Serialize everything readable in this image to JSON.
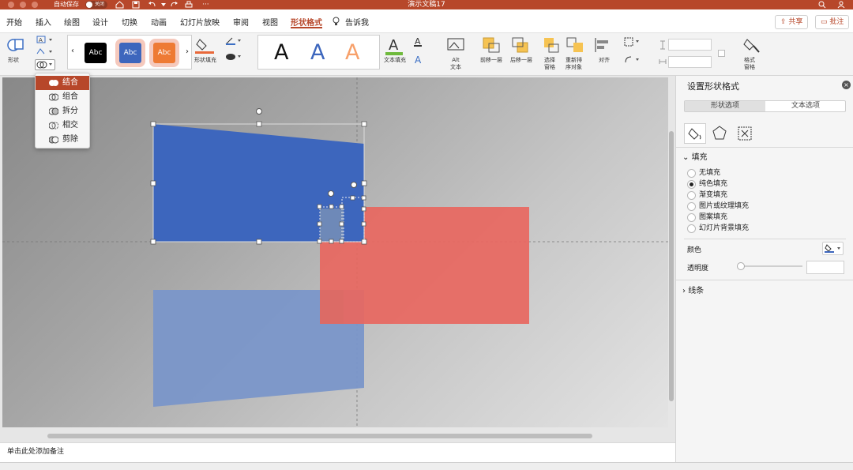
{
  "titlebar": {
    "autosave_label": "自动保存",
    "autosave_toggle": "关闭",
    "doc_title": "演示文稿17",
    "quick_more": "···"
  },
  "tabs": [
    "开始",
    "插入",
    "绘图",
    "设计",
    "切换",
    "动画",
    "幻灯片放映",
    "审阅",
    "视图",
    "形状格式"
  ],
  "tell_me": "告诉我",
  "share_label": "共享",
  "comment_label": "批注",
  "ribbon": {
    "shapes_label": "形状",
    "style_samples": [
      "Abc",
      "Abc",
      "Abc"
    ],
    "shape_fill_label": "形状填充",
    "wordart_samples": [
      "A",
      "A",
      "A"
    ],
    "text_fill_label": "文本填充",
    "alt_text_label": "Alt\n文本",
    "bring_forward_label": "前移一层",
    "send_backward_label": "后移一层",
    "selection_pane_label": "选择\n窗格",
    "reorder_label": "重新排\n序对象",
    "align_label": "对齐",
    "format_pane_label": "格式\n窗格"
  },
  "merge_menu": {
    "items": [
      "结合",
      "组合",
      "拆分",
      "相交",
      "剪除"
    ],
    "selected": "结合"
  },
  "notes_placeholder": "单击此处添加备注",
  "panel": {
    "title": "设置形状格式",
    "tabs": [
      "形状选项",
      "文本选项"
    ],
    "fill_section": "填充",
    "fill_options": [
      "无填充",
      "纯色填充",
      "渐变填充",
      "图片或纹理填充",
      "图案填充",
      "幻灯片背景填充"
    ],
    "fill_selected": "纯色填充",
    "color_label": "颜色",
    "transparency_label": "透明度",
    "line_section": "线条"
  },
  "colors": {
    "accent": "#b7472a",
    "blue_shape": "#3d66bd",
    "red_shape": "#e8675f",
    "light_blue_shape": "#7a96c9"
  }
}
